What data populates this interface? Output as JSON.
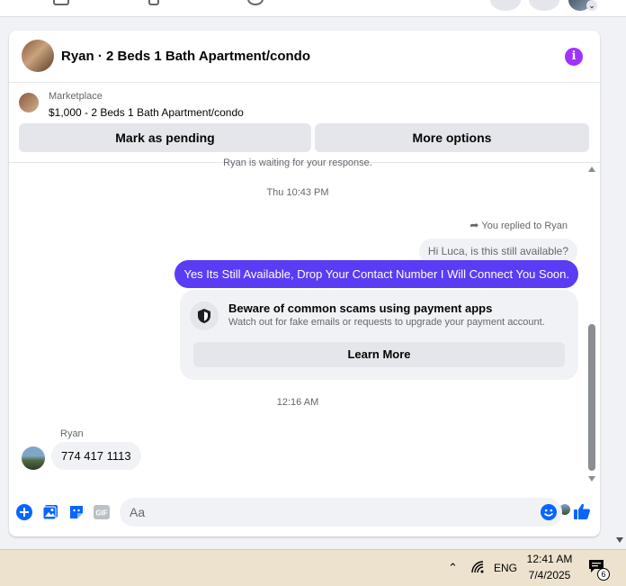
{
  "header": {
    "title": "Ryan · 2 Beds 1 Bath Apartment/condo",
    "info_icon": "info-icon",
    "info_glyph": "i"
  },
  "listing": {
    "label": "Marketplace",
    "price_title": "$1,000 - 2 Beds 1 Bath Apartment/condo",
    "mark_pending": "Mark as pending",
    "more_options": "More options"
  },
  "messages": {
    "waiting_note": "Ryan is waiting for your response.",
    "timestamp_1": "Thu 10:43 PM",
    "replied_to": "You replied to Ryan",
    "quoted_message": "Hi Luca, is this still available?",
    "sent_message": "Yes Its Still Available, Drop Your Contact Number I Will Connect You Soon.",
    "scam_title": "Beware of common scams using payment apps",
    "scam_subtitle": "Watch out for fake emails or requests to upgrade your payment account.",
    "learn_more": "Learn More",
    "timestamp_2": "12:16 AM",
    "sender_name": "Ryan",
    "incoming_message": "774 417 1113"
  },
  "composer": {
    "placeholder": "Aa",
    "icons": [
      "plus-icon",
      "photo-icon",
      "sticker-icon",
      "gif-icon",
      "emoji-icon",
      "thumbs-up-icon"
    ],
    "gif_label": "GIF"
  },
  "taskbar": {
    "language": "ENG",
    "time": "12:41 AM",
    "date": "7/4/2025",
    "notification_count": "6"
  },
  "colors": {
    "accent_blue": "#0866ff",
    "sent_bubble": "#5b3cf5",
    "info_purple": "#a033ff",
    "taskbar": "#ede2cd"
  }
}
